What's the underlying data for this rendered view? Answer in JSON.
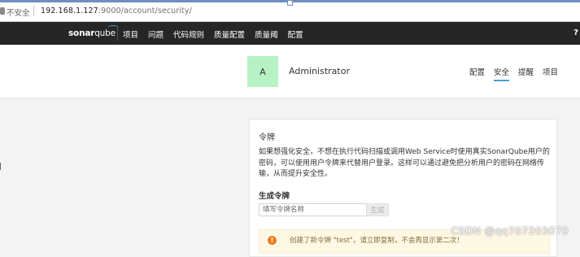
{
  "browser": {
    "security_label": "不安全",
    "url_host": "192.168.1.127",
    "url_path": ":9000/account/security/"
  },
  "topnav": {
    "logo_sonar": "sonar",
    "logo_qube": "qube",
    "items": [
      "项目",
      "问题",
      "代码规则",
      "质量配置",
      "质量阈",
      "配置"
    ],
    "help_glyph": "?"
  },
  "profile": {
    "avatar_letter": "A",
    "avatar_color": "#b7f2c5",
    "name": "Administrator",
    "tabs": [
      {
        "label": "配置",
        "active": false
      },
      {
        "label": "安全",
        "active": true
      },
      {
        "label": "提醒",
        "active": false
      },
      {
        "label": "项目",
        "active": false
      }
    ]
  },
  "tokens": {
    "title": "令牌",
    "description": "如果想强化安全，不想在执行代码扫描或调用Web Service时使用真实SonarQube用户的密码，可以使用用户令牌来代替用户登录。这样可以通过避免把分析用户的密码在网络传输，从而提升安全性。",
    "generate_title": "生成令牌",
    "input_placeholder": "填写令牌名称",
    "input_value": "",
    "generate_button": "生成",
    "alert_icon": "exclamation-icon",
    "alert_text": "创建了新令牌 \"test\"，请立即复制，不会再显示第二次！"
  },
  "colors": {
    "nav_bg": "#262626",
    "accent": "#4b9fd5",
    "alert_bg": "#fcf8e3"
  },
  "watermark": "CSDN @qq707203070"
}
